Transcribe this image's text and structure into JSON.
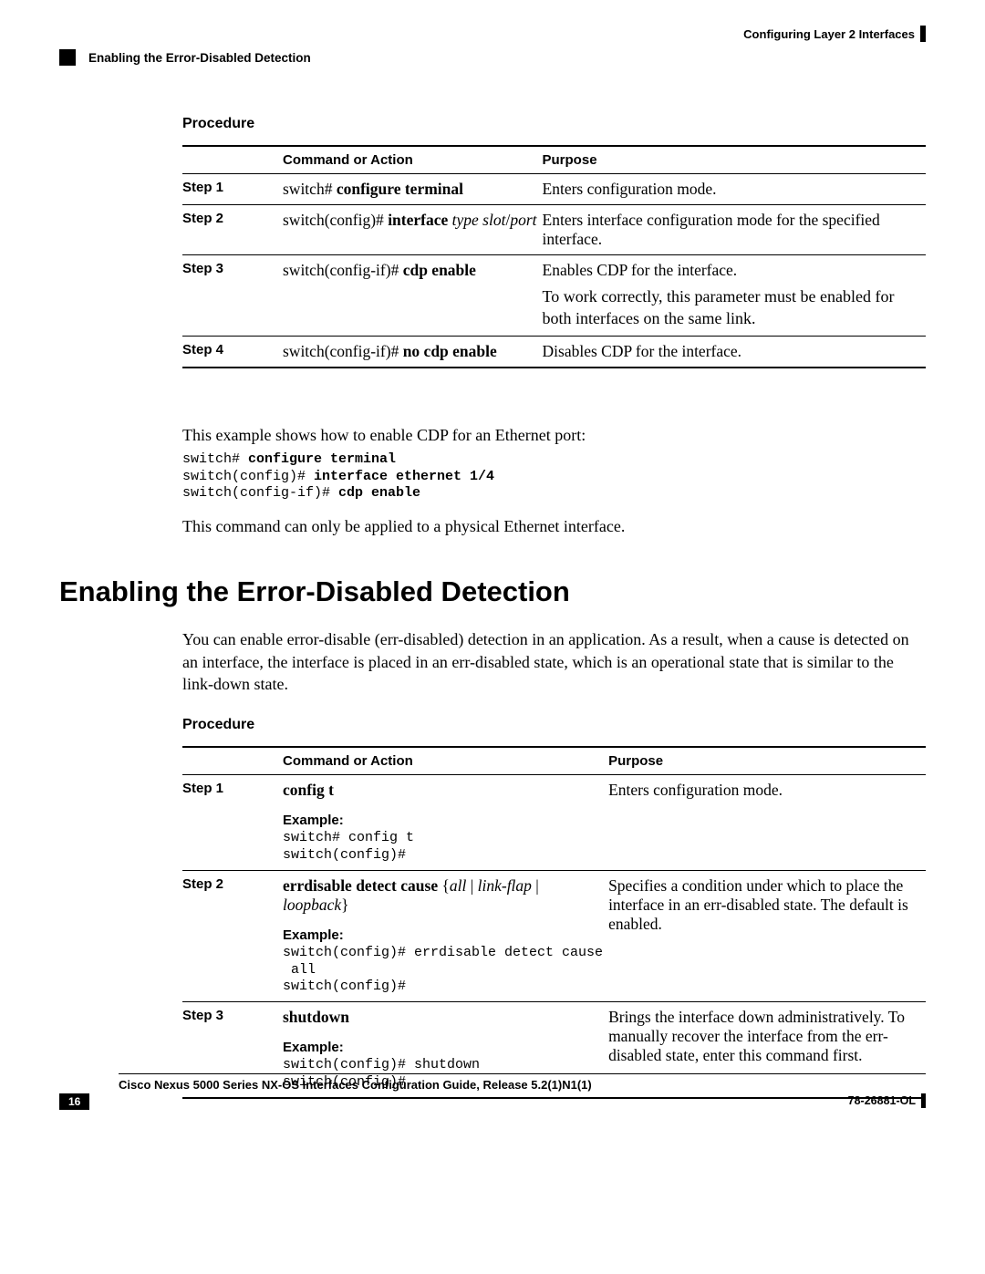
{
  "header": {
    "chapter": "Configuring Layer 2 Interfaces",
    "section": "Enabling the Error-Disabled Detection"
  },
  "proc1": {
    "label": "Procedure",
    "th_empty": "",
    "th_cmd": "Command or Action",
    "th_purpose": "Purpose",
    "s1": {
      "step": "Step 1",
      "prompt": "switch# ",
      "cmd": "configure terminal",
      "purpose": "Enters configuration mode."
    },
    "s2": {
      "step": "Step 2",
      "prompt": "switch(config)# ",
      "cmd": "interface",
      "args": " type slot",
      "slash": "/",
      "args2": "port",
      "purpose": "Enters interface configuration mode for the specified interface."
    },
    "s3": {
      "step": "Step 3",
      "prompt": "switch(config-if)# ",
      "cmd": "cdp enable",
      "p1": "Enables CDP for the interface.",
      "p2": "To work correctly, this parameter must be enabled for both interfaces on the same link."
    },
    "s4": {
      "step": "Step 4",
      "prompt": "switch(config-if)# ",
      "cmd": "no cdp enable",
      "purpose": "Disables CDP for the interface."
    }
  },
  "example1": {
    "intro": "This example shows how to enable CDP for an Ethernet port:",
    "l1a": "switch# ",
    "l1b": "configure terminal",
    "l2a": "switch(config)# ",
    "l2b": "interface ethernet 1/4",
    "l3a": "switch(config-if)# ",
    "l3b": "cdp enable",
    "note": "This command can only be applied to a physical Ethernet interface."
  },
  "h1": "Enabling the Error-Disabled Detection",
  "intro2": "You can enable error-disable (err-disabled) detection in an application. As a result, when a cause is detected on an interface, the interface is placed in an err-disabled state, which is an operational state that is similar to the link-down state.",
  "proc2": {
    "label": "Procedure",
    "th_empty": "",
    "th_cmd": "Command or Action",
    "th_purpose": "Purpose",
    "s1": {
      "step": "Step 1",
      "cmd": "config t",
      "ex_label": "Example:",
      "ex": "switch# config t\nswitch(config)#",
      "purpose": "Enters configuration mode."
    },
    "s2": {
      "step": "Step 2",
      "cmd_a": "errdisable detect cause",
      "cmd_b": " {",
      "cmd_c": "all",
      "cmd_d": " | ",
      "cmd_e": "link-flap",
      "cmd_f": " | ",
      "cmd_g": "loopback",
      "cmd_h": "}",
      "ex_label": "Example:",
      "ex": "switch(config)# errdisable detect cause\n all\nswitch(config)#",
      "purpose": "Specifies a condition under which to place the interface in an err-disabled state. The default is enabled."
    },
    "s3": {
      "step": "Step 3",
      "cmd": "shutdown",
      "ex_label": "Example:",
      "ex": "switch(config)# shutdown\nswitch(config)#",
      "purpose": "Brings the interface down administratively. To manually recover the interface from the err-disabled state, enter this command first."
    }
  },
  "footer": {
    "title": "Cisco Nexus 5000 Series NX-OS Interfaces Configuration Guide, Release 5.2(1)N1(1)",
    "page": "16",
    "doc": "78-26881-OL"
  }
}
